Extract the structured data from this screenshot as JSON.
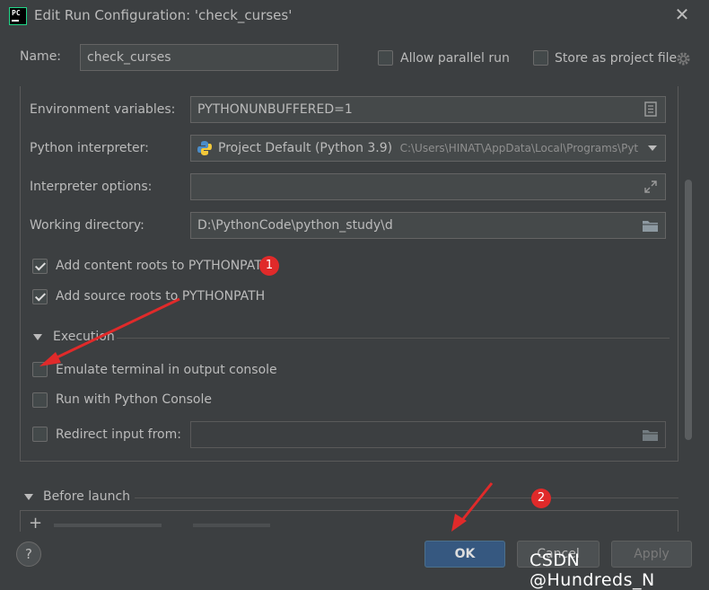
{
  "window": {
    "title": "Edit Run Configuration: 'check_curses'",
    "app_icon_text": "PC"
  },
  "header": {
    "name_label": "Name:",
    "name_value": "check_curses",
    "allow_parallel_label": "Allow parallel run",
    "allow_parallel_checked": false,
    "store_project_label": "Store as project file",
    "store_project_checked": false
  },
  "form": {
    "env_label": "Environment variables:",
    "env_value": "PYTHONUNBUFFERED=1",
    "interp_label": "Python interpreter:",
    "interp_value": "Project Default (Python 3.9)",
    "interp_path": "C:\\Users\\HINAT\\AppData\\Local\\Programs\\Pyt",
    "interp_opts_label": "Interpreter options:",
    "interp_opts_value": "",
    "workdir_label": "Working directory:",
    "workdir_value": "D:\\PythonCode\\python_study\\d",
    "content_roots_label": "Add content roots to PYTHONPATH",
    "content_roots_checked": true,
    "source_roots_label": "Add source roots to PYTHONPATH",
    "source_roots_checked": true
  },
  "execution": {
    "section_label": "Execution",
    "emulate_label": "Emulate terminal in output console",
    "emulate_checked": false,
    "python_console_label": "Run with Python Console",
    "python_console_checked": false,
    "redirect_label": "Redirect input from:",
    "redirect_checked": false,
    "redirect_value": ""
  },
  "before_launch": {
    "section_label": "Before launch",
    "add_icon": "+"
  },
  "footer": {
    "help_label": "?",
    "ok_label": "OK",
    "cancel_label": "Cancel",
    "apply_label": "Apply"
  },
  "annotations": {
    "badge1": "1",
    "badge2": "2",
    "arrow_color": "#e02a2a"
  },
  "watermark": "CSDN @Hundreds_N"
}
